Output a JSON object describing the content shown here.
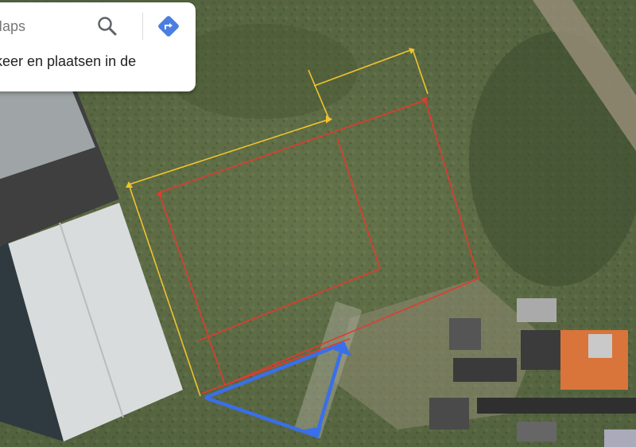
{
  "search": {
    "value": "Maps",
    "search_icon": "search-icon",
    "directions_icon": "directions-icon"
  },
  "result": {
    "text": "rkeer en plaatsen in de"
  },
  "colors": {
    "yellow_markup": "#f2c230",
    "red_markup": "#e23a30",
    "blue_markup": "#3a6fe8",
    "directions_blue": "#4a7fe0",
    "vegetation": "#5a6a45",
    "roof_light": "#d9dcdc",
    "roof_dark": "#3f3f3f",
    "house_roof": "#d9743a"
  }
}
